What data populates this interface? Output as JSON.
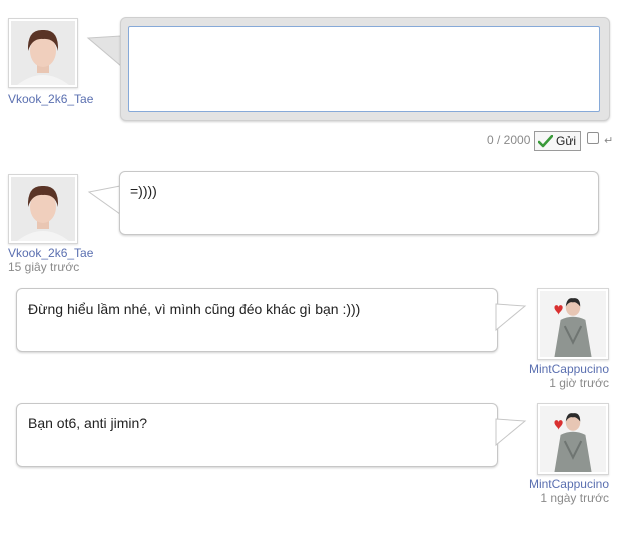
{
  "composer": {
    "user": "Vkook_2k6_Tae",
    "input_value": "",
    "counter": "0 / 2000",
    "send_label": "Gửi",
    "enter_glyph": "↵"
  },
  "messages": [
    {
      "user": "Vkook_2k6_Tae",
      "time": "15 giây trước",
      "text": "=))))"
    },
    {
      "user": "MintCappucino",
      "time": "1 giờ trước",
      "text": "Đừng hiểu lầm nhé, vì mình cũng đéo khác gì bạn :)))"
    },
    {
      "user": "MintCappucino",
      "time": "1 ngày trước",
      "text": "Bạn ot6, anti jimin?"
    }
  ],
  "colors": {
    "username": "#5a6fb0",
    "composer_bg": "#e3e3e3",
    "textarea_border": "#86a9d8",
    "send_check": "#3a9a3a"
  }
}
